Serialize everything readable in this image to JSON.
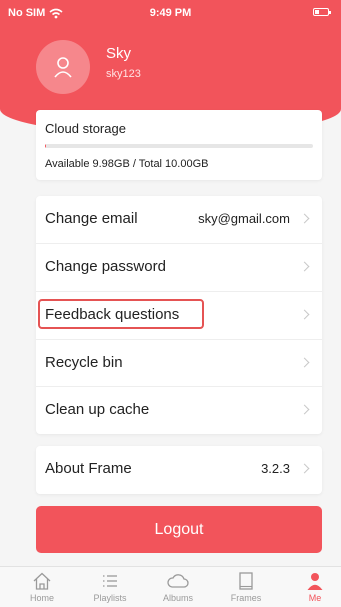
{
  "status_bar": {
    "carrier": "No SIM",
    "time": "9:49 PM"
  },
  "profile": {
    "name": "Sky",
    "user_id": "sky123"
  },
  "storage": {
    "title": "Cloud storage",
    "usage_text": "Available 9.98GB / Total 10.00GB",
    "used_fraction": 0.002
  },
  "settings": {
    "change_email_label": "Change email",
    "email_value": "sky@gmail.com",
    "change_password_label": "Change password",
    "feedback_label": "Feedback questions",
    "recycle_bin_label": "Recycle bin",
    "clean_cache_label": "Clean up cache"
  },
  "about": {
    "label": "About Frame",
    "version": "3.2.3"
  },
  "logout_label": "Logout",
  "tabbar": {
    "home": "Home",
    "playlists": "Playlists",
    "albums": "Albums",
    "frames": "Frames",
    "me": "Me",
    "active": "me"
  },
  "colors": {
    "accent": "#f2545b",
    "highlight_border": "#e55353",
    "inactive": "#9a9a9a"
  }
}
